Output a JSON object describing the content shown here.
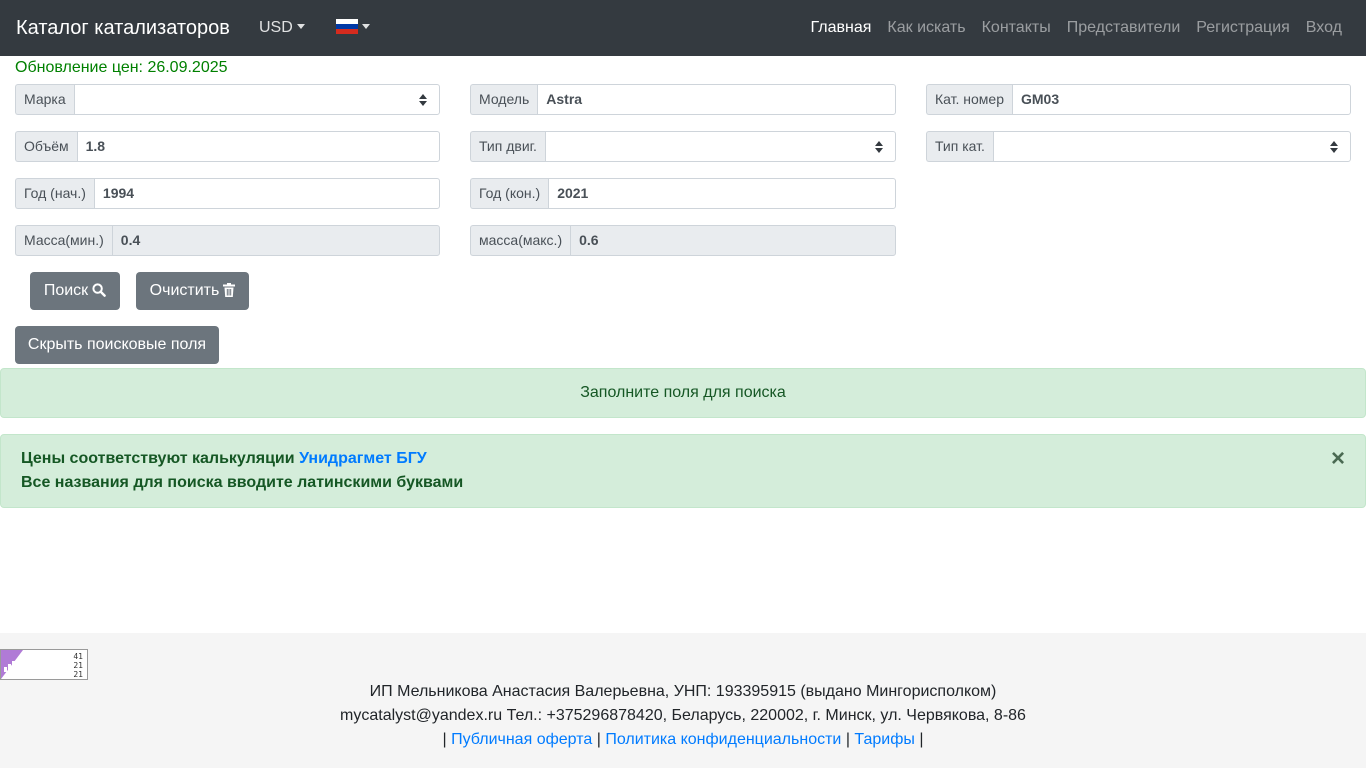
{
  "nav": {
    "brand": "Каталог катализаторов",
    "currency": "USD",
    "flag_colors": [
      "#ffffff",
      "#0039a6",
      "#d52b1e"
    ],
    "links": [
      "Главная",
      "Как искать",
      "Контакты",
      "Представители",
      "Регистрация",
      "Вход"
    ],
    "active": "Главная"
  },
  "update": {
    "text": "Обновление цен: 26.09.2025",
    "color": "#008000"
  },
  "form": {
    "brand": {
      "label": "Марка",
      "value": ""
    },
    "model": {
      "label": "Модель",
      "value": "Astra"
    },
    "cat_number": {
      "label": "Кат. номер",
      "value": "GM03"
    },
    "volume": {
      "label": "Объём",
      "value": "1.8"
    },
    "engine_type": {
      "label": "Тип двиг.",
      "value": ""
    },
    "cat_type": {
      "label": "Тип кат.",
      "value": ""
    },
    "year_start": {
      "label": "Год (нач.)",
      "value": "1994"
    },
    "year_end": {
      "label": "Год (кон.)",
      "value": "2021"
    },
    "mass_min": {
      "label": "Масса(мин.)",
      "value": "0.4"
    },
    "mass_max": {
      "label": "масса(макс.)",
      "value": "0.6"
    }
  },
  "buttons": {
    "search": "Поиск",
    "clear": "Очистить",
    "hide": "Скрыть поисковые поля"
  },
  "alerts": {
    "fill": "Заполните поля для поиска",
    "prices_prefix": "Цены соответствуют калькуляции",
    "prices_link": "Унидрагмет БГУ",
    "latin_note": "Все названия для поиска вводите латинскими буквами",
    "close": "×"
  },
  "footer": {
    "counter": [
      "41",
      "21",
      "21"
    ],
    "line1": "ИП Мельникова Анастасия Валерьевна, УНП: 193395915 (выдано Мингорисполком)",
    "line2": "mycatalyst@yandex.ru Тел.: +375296878420, Беларусь, 220002, г. Минск, ул. Червякова, 8-86",
    "sep": "|",
    "links": [
      "Публичная оферта",
      "Политика конфиденциальности",
      "Тарифы"
    ]
  },
  "colors": {
    "navbar": "#343a40",
    "button": "#6c757d",
    "alert_bg": "#d4edda",
    "alert_text": "#155724",
    "link": "#007bff"
  }
}
